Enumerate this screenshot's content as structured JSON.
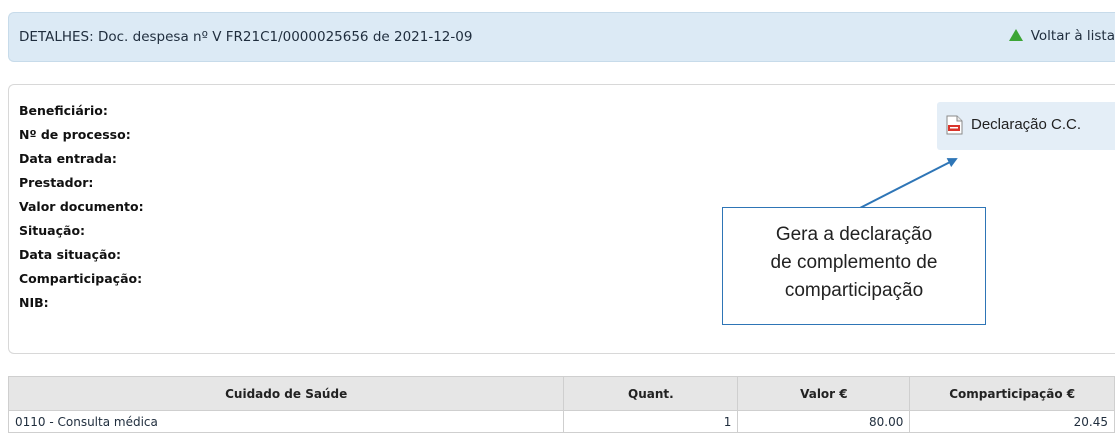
{
  "header": {
    "title": "DETALHES: Doc. despesa nº V FR21C1/0000025656 de 2021-12-09",
    "back_link": "Voltar à lista"
  },
  "details": {
    "fields": [
      "Beneficiário:",
      "Nº de processo:",
      "Data entrada:",
      "Prestador:",
      "Valor documento:",
      "Situação:",
      "Data situação:",
      "Comparticipação:",
      "NIB:"
    ],
    "declaration_button": "Declaração C.C."
  },
  "callout": {
    "lines": [
      "Gera a declaração",
      "de complemento de",
      "comparticipação"
    ]
  },
  "table": {
    "columns": [
      "Cuidado de Saúde",
      "Quant.",
      "Valor €",
      "Comparticipação €"
    ],
    "rows": [
      [
        "0110 - Consulta médica",
        "1",
        "80.00",
        "20.45"
      ]
    ]
  },
  "colors": {
    "header_bg": "#dceaf5",
    "accent_green": "#3ca535",
    "callout_border": "#2e75b6"
  },
  "icons": {
    "back": "green-triangle-up-icon",
    "declaration": "pdf-file-icon"
  }
}
